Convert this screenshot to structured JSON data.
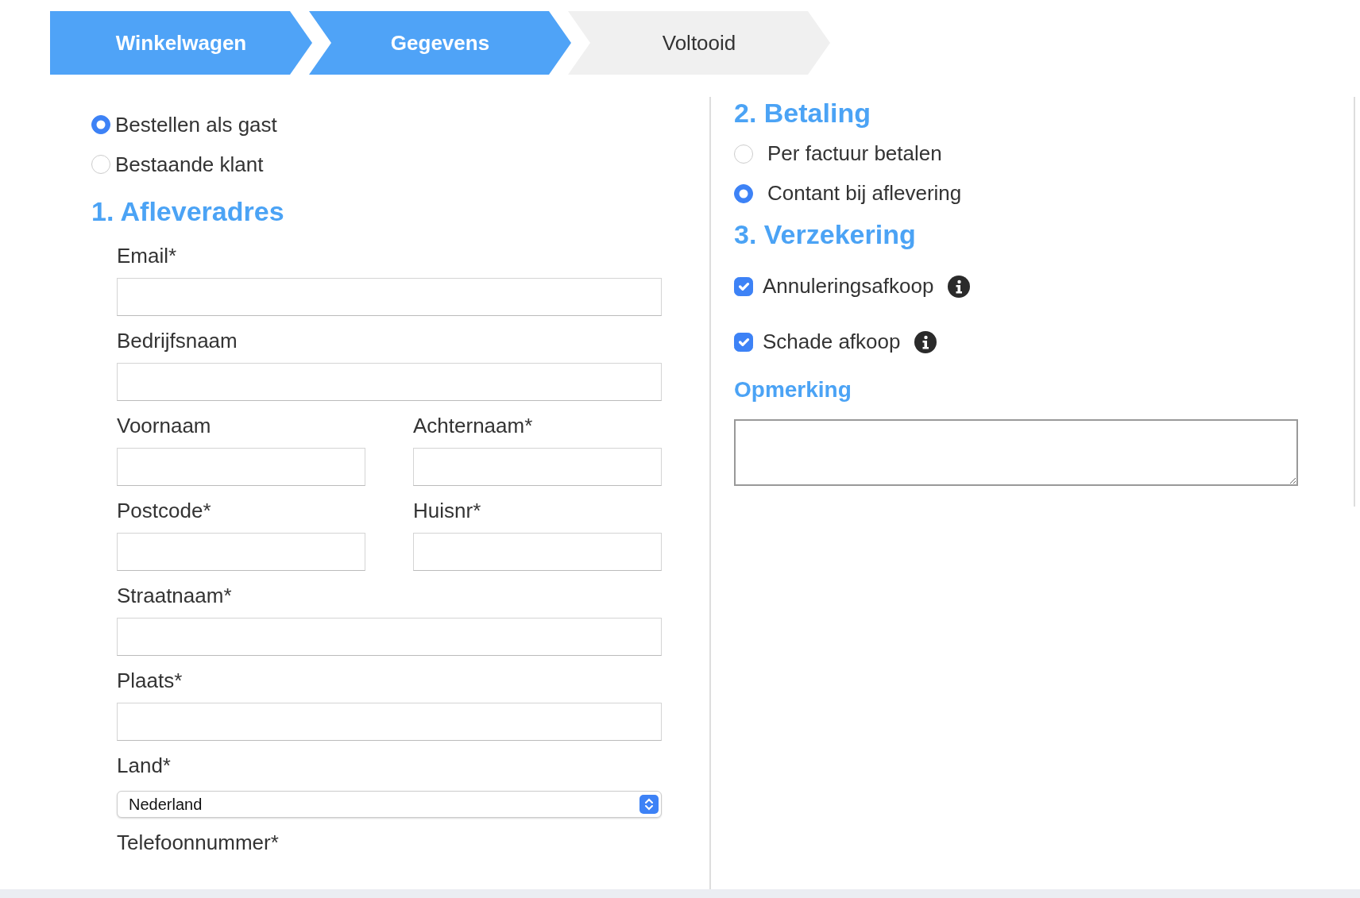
{
  "steps": [
    {
      "label": "Winkelwagen",
      "reached": true
    },
    {
      "label": "Gegevens",
      "reached": true
    },
    {
      "label": "Voltooid",
      "reached": false
    }
  ],
  "account_options": [
    {
      "label": "Bestellen als gast",
      "selected": true
    },
    {
      "label": "Bestaande klant",
      "selected": false
    }
  ],
  "delivery": {
    "title": "1. Afleveradres",
    "rows": [
      [
        {
          "label": "Email*",
          "kind": "text"
        }
      ],
      [
        {
          "label": "Bedrijfsnaam",
          "kind": "text"
        }
      ],
      [
        {
          "label": "Voornaam",
          "kind": "text"
        },
        {
          "label": "Achternaam*",
          "kind": "text"
        }
      ],
      [
        {
          "label": "Postcode*",
          "kind": "text"
        },
        {
          "label": "Huisnr*",
          "kind": "text"
        }
      ],
      [
        {
          "label": "Straatnaam*",
          "kind": "text"
        }
      ],
      [
        {
          "label": "Plaats*",
          "kind": "text"
        }
      ],
      [
        {
          "label": "Land*",
          "kind": "select",
          "value": "Nederland"
        }
      ],
      [
        {
          "label": "Telefoonnummer*",
          "kind": "label"
        }
      ]
    ]
  },
  "payment": {
    "title": "2. Betaling",
    "options": [
      {
        "label": "Per factuur betalen",
        "selected": false
      },
      {
        "label": "Contant bij aflevering",
        "selected": true
      }
    ]
  },
  "insurance": {
    "title": "3. Verzekering",
    "options": [
      {
        "label": "Annuleringsafkoop",
        "checked": true
      },
      {
        "label": "Schade afkoop",
        "checked": true
      }
    ]
  },
  "remark": {
    "title": "Opmerking"
  }
}
